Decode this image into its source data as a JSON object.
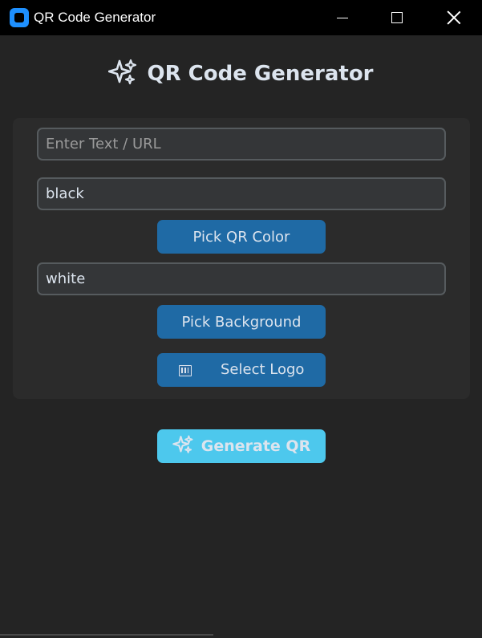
{
  "window": {
    "title": "QR Code Generator",
    "icon": "app-icon",
    "controls": [
      "minimize-icon",
      "maximize-icon",
      "close-icon"
    ]
  },
  "header": {
    "icon": "sparkle-icon",
    "title": "QR Code Generator"
  },
  "form": {
    "text_input": {
      "value": "",
      "placeholder": "Enter Text / URL"
    },
    "qr_color_input": {
      "value": "black"
    },
    "pick_qr_color_label": "Pick QR Color",
    "bg_color_input": {
      "value": "white"
    },
    "pick_background_label": "Pick Background",
    "select_logo": {
      "icon": "image-icon",
      "label": "Select Logo"
    }
  },
  "generate": {
    "icon": "sparkle-icon",
    "label": "Generate QR"
  },
  "colors": {
    "background": "#242424",
    "panel": "#2b2b2b",
    "button": "#1f6aa5",
    "generate_button": "#4dc8ed",
    "text": "#dce4ee"
  }
}
